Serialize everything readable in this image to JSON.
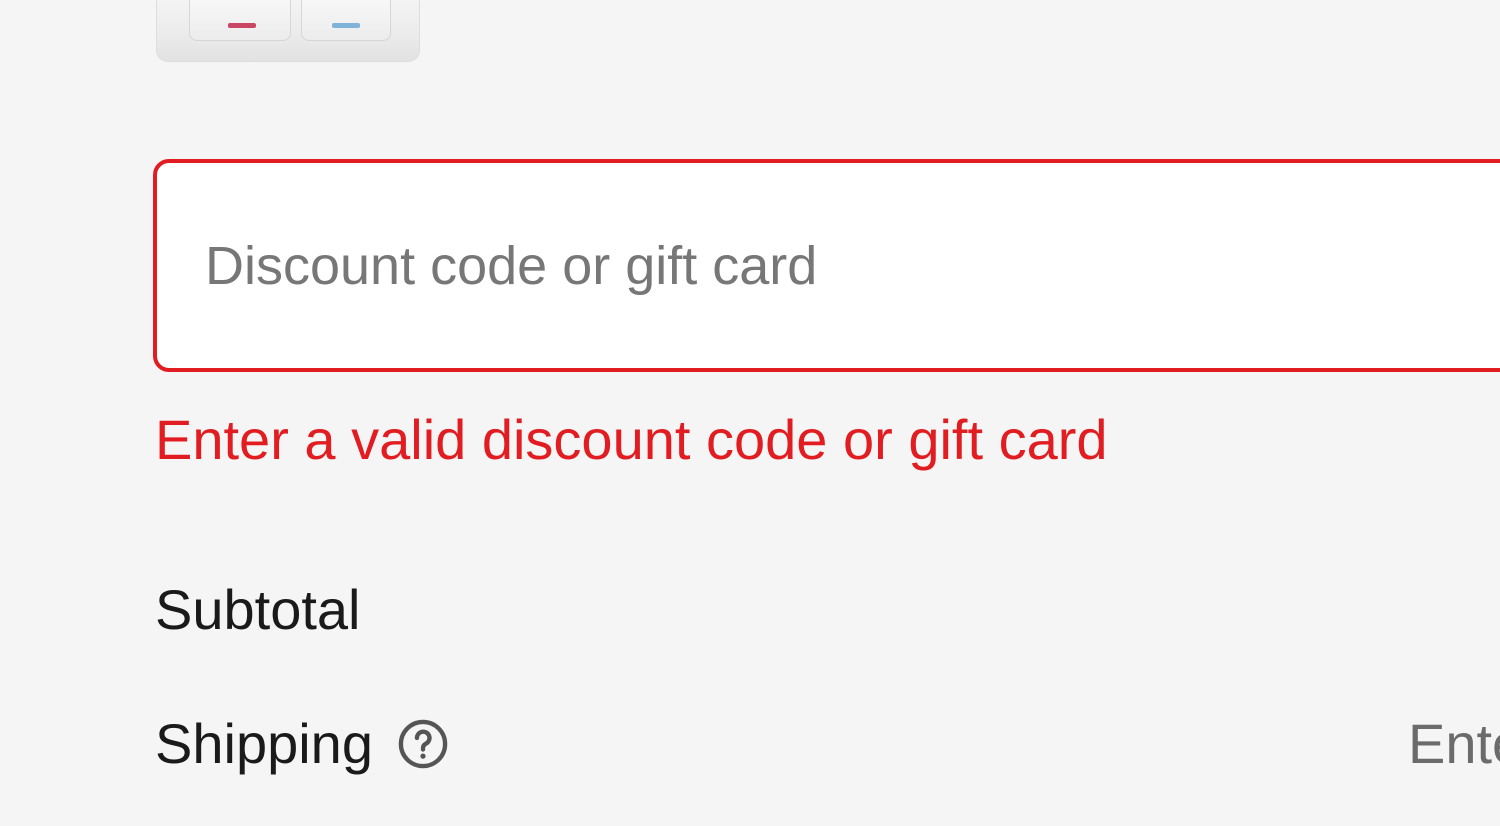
{
  "product": {
    "thumbnail_alt": "Product thumbnail"
  },
  "discount": {
    "placeholder": "Discount code or gift card",
    "value": "",
    "error": "Enter a valid discount code or gift card",
    "error_color": "#e11d22"
  },
  "summary": {
    "subtotal_label": "Subtotal",
    "shipping_label": "Shipping",
    "shipping_help_icon": "help-circle-icon",
    "shipping_value": "Ente"
  }
}
